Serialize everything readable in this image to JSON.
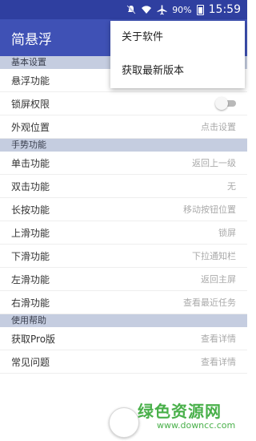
{
  "status_bar": {
    "battery_text": "90%",
    "time": "15:59"
  },
  "app_bar": {
    "title": "简悬浮"
  },
  "overflow_menu": {
    "items": [
      "关于软件",
      "获取最新版本"
    ]
  },
  "sections": {
    "basic": {
      "header": "基本设置",
      "float_label": "悬浮功能",
      "float_toggle_on": true,
      "lock_label": "锁屏权限",
      "lock_toggle_on": false,
      "appearance_label": "外观位置",
      "appearance_value": "点击设置"
    },
    "gestures": {
      "header": "手势功能",
      "rows": [
        {
          "label": "单击功能",
          "value": "返回上一级"
        },
        {
          "label": "双击功能",
          "value": "无"
        },
        {
          "label": "长按功能",
          "value": "移动按钮位置"
        },
        {
          "label": "上滑功能",
          "value": "锁屏"
        },
        {
          "label": "下滑功能",
          "value": "下拉通知栏"
        },
        {
          "label": "左滑功能",
          "value": "返回主屏"
        },
        {
          "label": "右滑功能",
          "value": "查看最近任务"
        }
      ]
    },
    "help": {
      "header": "使用帮助",
      "rows": [
        {
          "label": "获取Pro版",
          "value": "查看详情"
        },
        {
          "label": "常见问题",
          "value": "查看详情"
        }
      ]
    }
  },
  "watermark": {
    "title": "绿色资源网",
    "url": "www.downcc.com"
  },
  "colors": {
    "app_bar": "#3f51b5",
    "status_bar": "#2f3fa0",
    "section_header": "#c5cde0",
    "accent_toggle": "#1e8a7d",
    "watermark": "#49b04a"
  }
}
